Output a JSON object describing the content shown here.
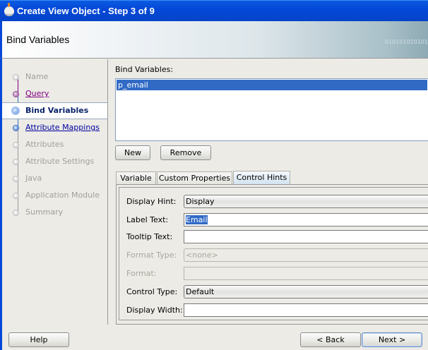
{
  "window": {
    "title": "Create View Object - Step 3 of 9"
  },
  "header": {
    "title": "Bind Variables",
    "watermark": "010101010101"
  },
  "steps": [
    {
      "label": "Name",
      "state": "disabled"
    },
    {
      "label": "Query",
      "state": "visited"
    },
    {
      "label": "Bind Variables",
      "state": "current"
    },
    {
      "label": "Attribute Mappings",
      "state": "next"
    },
    {
      "label": "Attributes",
      "state": "disabled"
    },
    {
      "label": "Attribute Settings",
      "state": "disabled"
    },
    {
      "label": "Java",
      "state": "disabled"
    },
    {
      "label": "Application Module",
      "state": "disabled"
    },
    {
      "label": "Summary",
      "state": "disabled"
    }
  ],
  "bind": {
    "label": "Bind Variables:",
    "items": [
      "p_email"
    ],
    "new_label": "New",
    "remove_label": "Remove"
  },
  "tabs": [
    "Variable",
    "Custom Properties",
    "Control Hints"
  ],
  "form": {
    "display_hint": {
      "label": "Display Hint:",
      "value": "Display"
    },
    "label_text": {
      "label": "Label Text:",
      "value": "Email"
    },
    "tooltip_text": {
      "label": "Tooltip Text:",
      "value": ""
    },
    "format_type": {
      "label": "Format Type:",
      "value": "<none>"
    },
    "format": {
      "label": "Format:",
      "value": ""
    },
    "control_type": {
      "label": "Control Type:",
      "value": "Default"
    },
    "display_width": {
      "label": "Display Width:",
      "value": ""
    }
  },
  "footer": {
    "help": "Help",
    "back": "< Back",
    "next": "Next >"
  }
}
